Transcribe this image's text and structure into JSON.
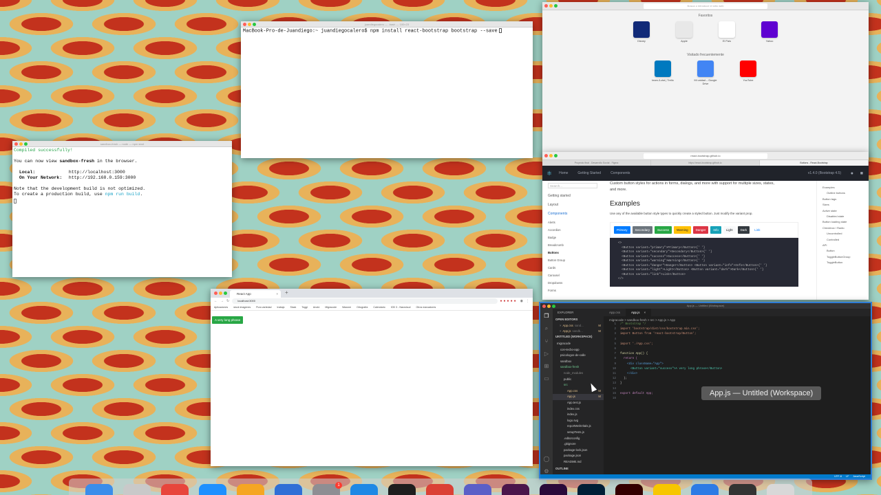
{
  "term_npm": {
    "title": "juandiegocalero — -bash — 100×23",
    "prompt": "MacBook-Pro-de-Juandiego:~ juandiegocalero$ npm install react-bootstrap bootstrap --save"
  },
  "term_dev": {
    "title": "sandbox-fresh — node — npm start",
    "compiled": "Compiled successfully!",
    "view_pre": "You can now view ",
    "app_name": "sandbox-fresh",
    "view_post": " in the browser.",
    "local_label": "Local:",
    "local_url": "http://localhost:3000",
    "network_label": "On Your Network:",
    "network_url": "http://192.168.0.159:3000",
    "note1": "Note that the development build is not optimized.",
    "note2_pre": "To create a production build, use ",
    "note2_cmd": "npm run build",
    "note2_post": "."
  },
  "safari_top": {
    "address": "Busca o introduce el sitio web",
    "favorites_title": "Favoritos",
    "favorites": [
      {
        "label": "Disney",
        "icon": "disney-icon",
        "color": "#112a78"
      },
      {
        "label": "Apple",
        "icon": "apple-icon",
        "color": "#e8e8e8"
      },
      {
        "label": "El País",
        "icon": "elpais-icon",
        "color": "#ffffff"
      },
      {
        "label": "Yahoo",
        "icon": "yahoo-icon",
        "color": "#5f01d1"
      }
    ],
    "frequent_title": "Visitado frecuentemente",
    "frequent": [
      {
        "label": "team-3-ctst | Trello",
        "icon": "trello-icon",
        "color": "#0079bf"
      },
      {
        "label": "Mi unidad – Google Drive",
        "icon": "google-icon",
        "color": "#4285f4"
      },
      {
        "label": "YouTube",
        "icon": "youtube-icon",
        "color": "#ff0000"
      }
    ]
  },
  "docs": {
    "address": "react-bootstrap.github.io",
    "tabs": [
      "Proyecto final - Desarrollo Social - Figma",
      "https://react-bootstrap.github.io",
      "Buttons - React-Bootstrap"
    ],
    "nav": [
      "Home",
      "Getting Started",
      "Components"
    ],
    "version": "v1.4.0 (Bootstrap 4.5)",
    "search_placeholder": "Search...",
    "sidebar": [
      "Getting started",
      "Layout",
      "Components",
      "Alerts",
      "Accordion",
      "Badge",
      "Breadcrumb",
      "Buttons",
      "Button Group",
      "Cards",
      "Carousel",
      "Dropdowns",
      "Forms"
    ],
    "intro": "Custom button styles for actions in forms, dialogs, and more with support for multiple sizes, states, and more.",
    "heading": "Examples",
    "desc": "Use any of the available button style types to quickly create a styled button. Just modify the variant prop.",
    "buttons": [
      {
        "label": "Primary",
        "bg": "#007bff",
        "fg": "#fff"
      },
      {
        "label": "Secondary",
        "bg": "#6c757d",
        "fg": "#fff"
      },
      {
        "label": "Success",
        "bg": "#28a745",
        "fg": "#fff"
      },
      {
        "label": "Warning",
        "bg": "#ffc107",
        "fg": "#212529"
      },
      {
        "label": "Danger",
        "bg": "#dc3545",
        "fg": "#fff"
      },
      {
        "label": "Info",
        "bg": "#17a2b8",
        "fg": "#fff"
      },
      {
        "label": "Light",
        "bg": "#f8f9fa",
        "fg": "#212529"
      },
      {
        "label": "Dark",
        "bg": "#343a40",
        "fg": "#fff"
      },
      {
        "label": "Link",
        "bg": "transparent",
        "fg": "#007bff"
      }
    ],
    "code": [
      "<>",
      "  <Button variant=\"primary\">Primary</Button>{' '}",
      "  <Button variant=\"secondary\">Secondary</Button>{' '}",
      "  <Button variant=\"success\">Success</Button>{' '}",
      "  <Button variant=\"warning\">Warning</Button>{' '}",
      "  <Button variant=\"danger\">Danger</Button> <Button variant=\"info\">Info</Button>{' '}",
      "  <Button variant=\"light\">Light</Button> <Button variant=\"dark\">Dark</Button>{' '}",
      "  <Button variant=\"link\">Link</Button>",
      "</>"
    ],
    "toc": [
      "Examples",
      "Outline buttons",
      "Button tags",
      "Sizes",
      "Active state",
      "Disabled state",
      "Button loading state",
      "Checkbox / Radio",
      "Uncontrolled",
      "Controlled",
      "API",
      "Button",
      "ToggleButtonGroup",
      "ToggleButton"
    ]
  },
  "chrome": {
    "tab": "React App",
    "url": "localhost:3000",
    "bookmarks": [
      "Aplicaciones",
      "stock imagenes",
      "Pura variedad",
      "trabajo",
      "Slack",
      "Toggl",
      "Anotó",
      "Migracode",
      "Wazone",
      "Ortografía",
      "Calendario",
      "IOD 3 - Nasrolcud",
      "Otros marcadores"
    ],
    "button": "A very long phrase"
  },
  "vscode": {
    "title": "App.js — Untitled (Workspace)",
    "explorer": "EXPLORER",
    "open_editors": "OPEN EDITORS",
    "open_files": [
      {
        "name": "App.css",
        "path": "sand...",
        "badge": "M"
      },
      {
        "name": "App.js",
        "path": "sandb...",
        "badge": "M"
      }
    ],
    "workspace": "UNTITLED (WORKSPACE)",
    "tree": [
      {
        "name": "migracode",
        "d": 0,
        "badge": "",
        "color": "#ccc"
      },
      {
        "name": "con-tecbo-app",
        "d": 1,
        "badge": "",
        "color": "#ccc"
      },
      {
        "name": "psicologos-de-calle",
        "d": 1,
        "badge": "",
        "color": "#ccc"
      },
      {
        "name": "sandbox",
        "d": 1,
        "badge": "",
        "color": "#ccc"
      },
      {
        "name": "sandbox-fresh",
        "d": 1,
        "badge": "",
        "color": "#73c991"
      },
      {
        "name": "node_modules",
        "d": 2,
        "badge": "",
        "color": "#888"
      },
      {
        "name": "public",
        "d": 2,
        "badge": "",
        "color": "#ccc"
      },
      {
        "name": "src",
        "d": 2,
        "badge": "",
        "color": "#73c991"
      },
      {
        "name": "App.css",
        "d": 3,
        "badge": "M",
        "color": "#e2c08d"
      },
      {
        "name": "App.js",
        "d": 3,
        "badge": "M",
        "color": "#e2c08d"
      },
      {
        "name": "App.test.js",
        "d": 3,
        "badge": "",
        "color": "#ccc"
      },
      {
        "name": "index.css",
        "d": 3,
        "badge": "",
        "color": "#ccc"
      },
      {
        "name": "index.js",
        "d": 3,
        "badge": "",
        "color": "#ccc"
      },
      {
        "name": "logo.svg",
        "d": 3,
        "badge": "",
        "color": "#ccc"
      },
      {
        "name": "reportWebVitals.js",
        "d": 3,
        "badge": "",
        "color": "#ccc"
      },
      {
        "name": "setupTests.js",
        "d": 3,
        "badge": "",
        "color": "#ccc"
      },
      {
        "name": ".editorconfig",
        "d": 2,
        "badge": "",
        "color": "#ccc"
      },
      {
        "name": ".gitignore",
        "d": 2,
        "badge": "",
        "color": "#ccc"
      },
      {
        "name": "package-lock.json",
        "d": 2,
        "badge": "",
        "color": "#ccc"
      },
      {
        "name": "package.json",
        "d": 2,
        "badge": "",
        "color": "#ccc"
      },
      {
        "name": "README.md",
        "d": 2,
        "badge": "",
        "color": "#ccc"
      }
    ],
    "outline": "OUTLINE",
    "tabs": [
      {
        "name": "App.css",
        "active": false
      },
      {
        "name": "App.js",
        "active": true
      }
    ],
    "breadcrumb": "migracode > sandbox-fresh > src > App.js > App",
    "code": [
      {
        "n": "1",
        "t": "/* Bootstrap */",
        "c": "#6a9955"
      },
      {
        "n": "2",
        "t": "import 'bootstrap/dist/css/bootstrap.min.css';",
        "c": "#ce9178"
      },
      {
        "n": "3",
        "t": "import Button from 'react-bootstrap/Button';",
        "c": "#ce9178"
      },
      {
        "n": "4",
        "t": "",
        "c": "#ccc"
      },
      {
        "n": "5",
        "t": "import './App.css';",
        "c": "#ce9178"
      },
      {
        "n": "6",
        "t": "",
        "c": "#ccc"
      },
      {
        "n": "7",
        "t": "function App() {",
        "c": "#dcdcaa"
      },
      {
        "n": "8",
        "t": "  return (",
        "c": "#c586c0"
      },
      {
        "n": "9",
        "t": "    <div className=\"App\">",
        "c": "#569cd6"
      },
      {
        "n": "10",
        "t": "      <Button variant=\"success\">A very long phrase</Button>",
        "c": "#4ec9b0"
      },
      {
        "n": "11",
        "t": "    </div>",
        "c": "#569cd6"
      },
      {
        "n": "12",
        "t": "  );",
        "c": "#ccc"
      },
      {
        "n": "13",
        "t": "}",
        "c": "#ccc"
      },
      {
        "n": "14",
        "t": "",
        "c": "#ccc"
      },
      {
        "n": "15",
        "t": "export default App;",
        "c": "#c586c0"
      },
      {
        "n": "16",
        "t": "",
        "c": "#ccc"
      }
    ],
    "tooltip": "App.js — Untitled (Workspace)",
    "status": [
      "UTF-8",
      "LF",
      "JavaScript"
    ]
  },
  "dock": {
    "badge": "1",
    "apps": [
      {
        "name": "finder",
        "color": "#3b8dea"
      },
      {
        "name": "launchpad",
        "color": "#c9c9c9"
      },
      {
        "name": "chrome",
        "color": "#e8453c"
      },
      {
        "name": "safari",
        "color": "#1e90ff"
      },
      {
        "name": "photos",
        "color": "#f5a623"
      },
      {
        "name": "mail",
        "color": "#2f6fd6"
      },
      {
        "name": "settings",
        "color": "#8e8e93"
      },
      {
        "name": "vscode",
        "color": "#1e88e5"
      },
      {
        "name": "terminal",
        "color": "#1e1e1e"
      },
      {
        "name": "todoist",
        "color": "#db4035"
      },
      {
        "name": "teams",
        "color": "#5b5fc7"
      },
      {
        "name": "slack",
        "color": "#4a154b"
      },
      {
        "name": "premiere",
        "color": "#2a0a3a"
      },
      {
        "name": "photoshop",
        "color": "#001e36"
      },
      {
        "name": "illustrator",
        "color": "#330000"
      },
      {
        "name": "cyberduck",
        "color": "#f7c600"
      },
      {
        "name": "ntfs",
        "color": "#2c7be5"
      },
      {
        "name": "keyboard",
        "color": "#333333"
      },
      {
        "name": "trash",
        "color": "#d8d8d8"
      }
    ]
  }
}
